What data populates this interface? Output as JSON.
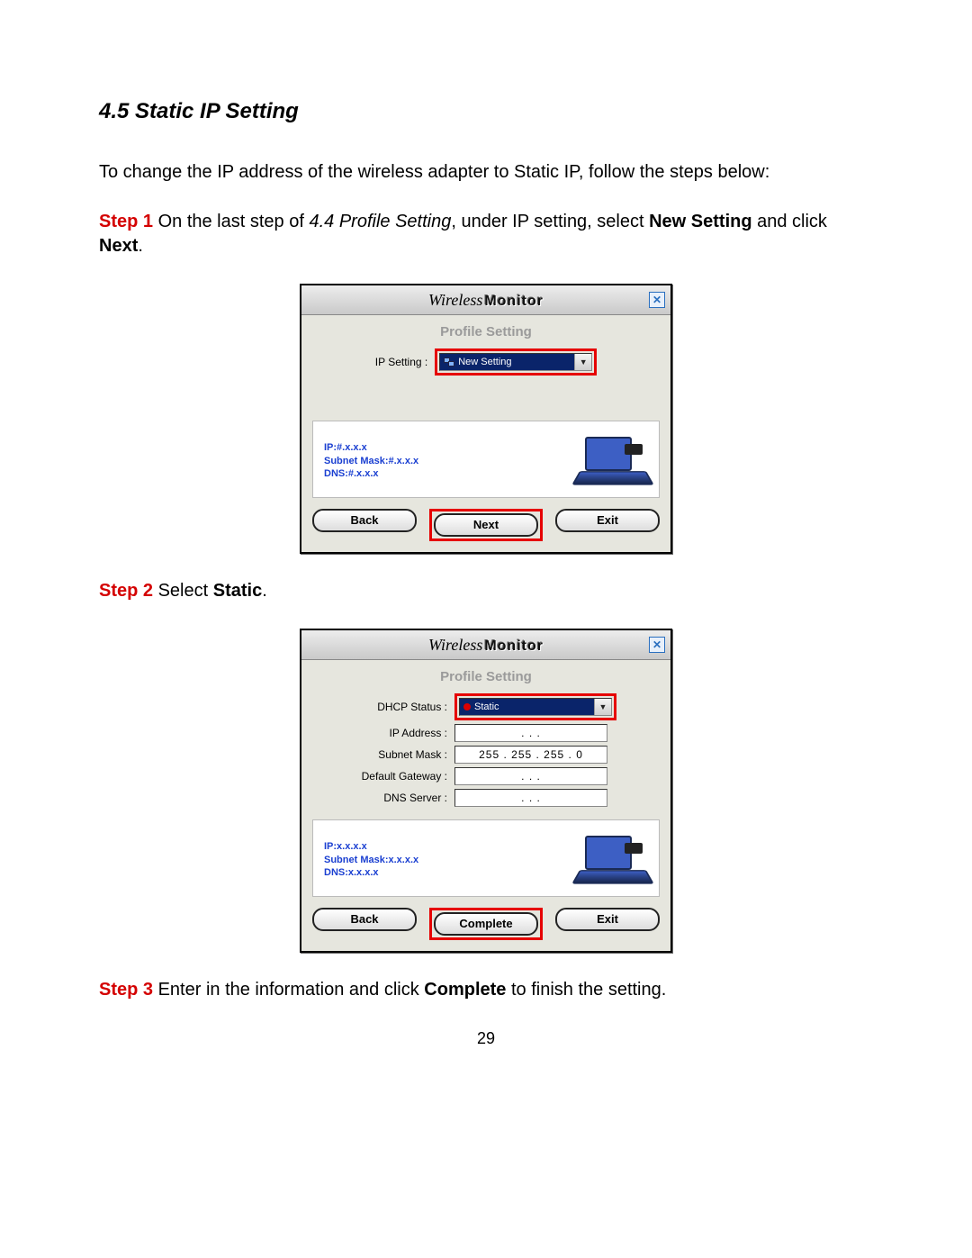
{
  "heading": "4.5 Static IP Setting",
  "intro": "To change the IP address of the wireless adapter to Static IP, follow the steps below:",
  "step1": {
    "label": "Step 1",
    "text_a": " On the last step of ",
    "ref": "4.4 Profile Setting",
    "text_b": ", under IP setting, select ",
    "bold1": "New Setting",
    "text_c": " and click ",
    "bold2": "Next",
    "text_d": "."
  },
  "step2": {
    "label": "Step 2",
    "text_a": " Select ",
    "bold1": "Static",
    "text_d": "."
  },
  "step3": {
    "label": "Step 3",
    "text_a": " Enter in the information and click ",
    "bold1": "Complete",
    "text_b": " to finish the setting."
  },
  "brand_script": "Wireless",
  "brand_mono": "Monitor",
  "close_glyph": "✕",
  "dialog1": {
    "subheading": "Profile Setting",
    "row_label": "IP Setting :",
    "dropdown_value": "New Setting",
    "info_line1": "IP:#.x.x.x",
    "info_line2": "Subnet Mask:#.x.x.x",
    "info_line3": "DNS:#.x.x.x",
    "btn_back": "Back",
    "btn_next": "Next",
    "btn_exit": "Exit"
  },
  "dialog2": {
    "subheading": "Profile Setting",
    "rows": {
      "dhcp_label": "DHCP Status :",
      "dhcp_value": "Static",
      "ip_label": "IP Address :",
      "ip_value": ".       .       .",
      "subnet_label": "Subnet Mask :",
      "subnet_value": "255 . 255 . 255 .   0",
      "gateway_label": "Default Gateway :",
      "gateway_value": ".       .       .",
      "dns_label": "DNS Server :",
      "dns_value": ".       .       ."
    },
    "info_line1": "IP:x.x.x.x",
    "info_line2": "Subnet Mask:x.x.x.x",
    "info_line3": "DNS:x.x.x.x",
    "btn_back": "Back",
    "btn_complete": "Complete",
    "btn_exit": "Exit"
  },
  "page_number": "29"
}
